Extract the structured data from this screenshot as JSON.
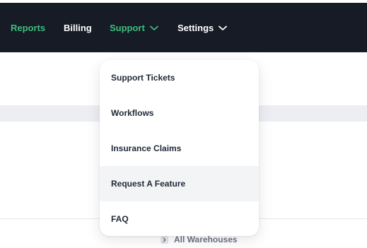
{
  "nav": {
    "items": [
      {
        "label": "Reports",
        "active": true,
        "has_dropdown": false
      },
      {
        "label": "Billing",
        "active": false,
        "has_dropdown": false
      },
      {
        "label": "Support",
        "active": true,
        "has_dropdown": true
      },
      {
        "label": "Settings",
        "active": false,
        "has_dropdown": true
      }
    ]
  },
  "support_menu": {
    "items": [
      {
        "label": "Support Tickets"
      },
      {
        "label": "Workflows"
      },
      {
        "label": "Insurance Claims"
      },
      {
        "label": "Request A Feature",
        "highlighted": true
      },
      {
        "label": "FAQ"
      }
    ]
  },
  "footer": {
    "warehouse_label": "All Warehouses",
    "icon": "chevron-right-icon"
  },
  "colors": {
    "navbar_bg": "#161b26",
    "accent_green": "#3ebd7c",
    "nav_text": "#ffffff",
    "menu_text": "#1f2937",
    "menu_hover_bg": "#f3f4f6",
    "band_bg": "#eceef3"
  }
}
